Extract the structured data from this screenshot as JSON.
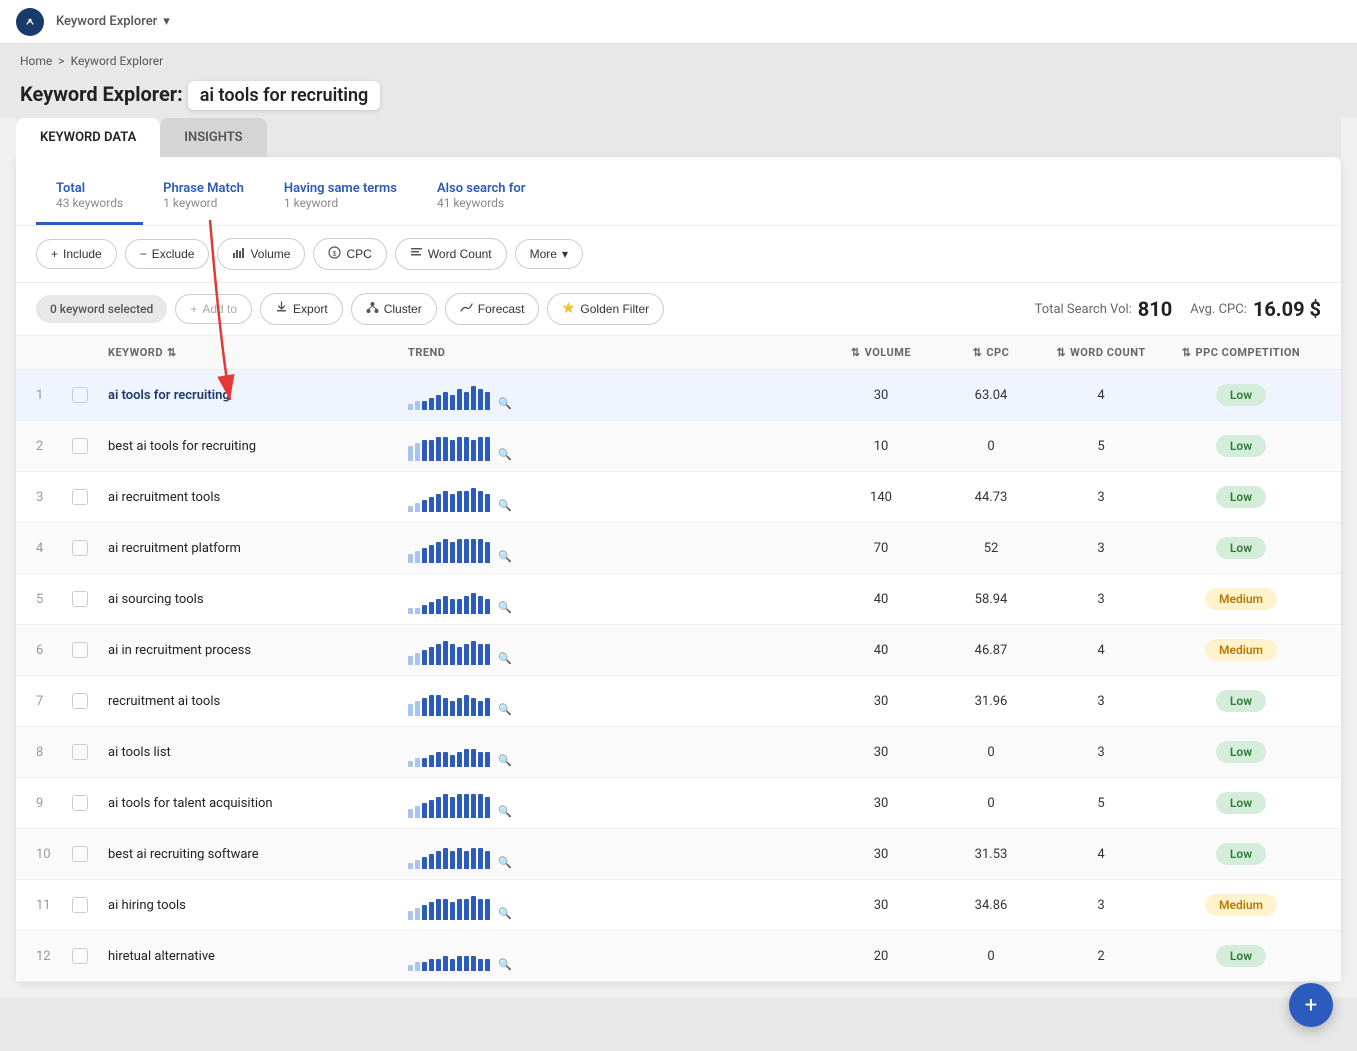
{
  "topbar": {
    "app_name": "Keyword Explorer",
    "chevron": "▾"
  },
  "breadcrumb": {
    "home": "Home",
    "separator": ">",
    "current": "Keyword Explorer"
  },
  "page_title": {
    "prefix": "Keyword Explorer:",
    "query": "ai tools for recruiting"
  },
  "tabs": [
    {
      "id": "keyword-data",
      "label": "KEYWORD DATA",
      "active": true
    },
    {
      "id": "insights",
      "label": "INSIGHTS",
      "active": false
    }
  ],
  "keyword_types": [
    {
      "id": "total",
      "label": "Total",
      "count": "43 keywords",
      "active": true
    },
    {
      "id": "phrase-match",
      "label": "Phrase Match",
      "count": "1 keyword",
      "active": false
    },
    {
      "id": "same-terms",
      "label": "Having same terms",
      "count": "1 keyword",
      "active": false
    },
    {
      "id": "also-search",
      "label": "Also search for",
      "count": "41 keywords",
      "active": false
    }
  ],
  "filters": [
    {
      "id": "include",
      "label": "Include",
      "icon": "+"
    },
    {
      "id": "exclude",
      "label": "Exclude",
      "icon": "−"
    },
    {
      "id": "volume",
      "label": "Volume",
      "icon": "📊"
    },
    {
      "id": "cpc",
      "label": "CPC",
      "icon": "💲"
    },
    {
      "id": "word-count",
      "label": "Word Count",
      "icon": "📝"
    },
    {
      "id": "more",
      "label": "More",
      "icon": "⋯",
      "has_arrow": true
    }
  ],
  "actions": {
    "selected_label": "0 keyword selected",
    "add_to": "+ Add to",
    "export": "Export",
    "cluster": "Cluster",
    "forecast": "Forecast",
    "golden_filter": "Golden Filter"
  },
  "totals": {
    "search_vol_label": "Total Search Vol:",
    "search_vol": "810",
    "avg_cpc_label": "Avg. CPC:",
    "avg_cpc": "16.09 $"
  },
  "table": {
    "headers": [
      {
        "id": "drag",
        "label": ""
      },
      {
        "id": "check",
        "label": ""
      },
      {
        "id": "keyword",
        "label": "KEYWORD"
      },
      {
        "id": "trend",
        "label": "TREND"
      },
      {
        "id": "volume",
        "label": "VOLUME"
      },
      {
        "id": "cpc",
        "label": "CPC"
      },
      {
        "id": "word-count",
        "label": "WORD COUNT"
      },
      {
        "id": "ppc",
        "label": "PPC COMPETITION"
      }
    ],
    "rows": [
      {
        "num": 1,
        "keyword": "ai tools for recruiting",
        "volume": 30,
        "cpc": "63.04",
        "word_count": 4,
        "ppc": "Low",
        "ppc_type": "low",
        "trend": [
          2,
          3,
          3,
          4,
          5,
          6,
          5,
          7,
          6,
          8,
          7,
          6
        ],
        "highlight": true
      },
      {
        "num": 2,
        "keyword": "best ai tools for recruiting",
        "volume": 10,
        "cpc": "0",
        "word_count": 5,
        "ppc": "Low",
        "ppc_type": "low",
        "trend": [
          5,
          6,
          7,
          7,
          8,
          8,
          7,
          8,
          8,
          7,
          8,
          8
        ]
      },
      {
        "num": 3,
        "keyword": "ai recruitment tools",
        "volume": 140,
        "cpc": "44.73",
        "word_count": 3,
        "ppc": "Low",
        "ppc_type": "low",
        "trend": [
          2,
          3,
          4,
          5,
          6,
          7,
          6,
          7,
          7,
          8,
          7,
          6
        ]
      },
      {
        "num": 4,
        "keyword": "ai recruitment platform",
        "volume": 70,
        "cpc": "52",
        "word_count": 3,
        "ppc": "Low",
        "ppc_type": "low",
        "trend": [
          3,
          4,
          5,
          6,
          7,
          8,
          7,
          8,
          8,
          8,
          8,
          7
        ]
      },
      {
        "num": 5,
        "keyword": "ai sourcing tools",
        "volume": 40,
        "cpc": "58.94",
        "word_count": 3,
        "ppc": "Medium",
        "ppc_type": "medium",
        "trend": [
          2,
          2,
          3,
          4,
          5,
          6,
          5,
          5,
          6,
          7,
          6,
          5
        ]
      },
      {
        "num": 6,
        "keyword": "ai in recruitment process",
        "volume": 40,
        "cpc": "46.87",
        "word_count": 4,
        "ppc": "Medium",
        "ppc_type": "medium",
        "trend": [
          3,
          4,
          5,
          6,
          7,
          8,
          7,
          6,
          7,
          8,
          7,
          7
        ]
      },
      {
        "num": 7,
        "keyword": "recruitment ai tools",
        "volume": 30,
        "cpc": "31.96",
        "word_count": 3,
        "ppc": "Low",
        "ppc_type": "low",
        "trend": [
          4,
          5,
          6,
          7,
          7,
          6,
          5,
          6,
          7,
          6,
          5,
          6
        ]
      },
      {
        "num": 8,
        "keyword": "ai tools list",
        "volume": 30,
        "cpc": "0",
        "word_count": 3,
        "ppc": "Low",
        "ppc_type": "low",
        "trend": [
          2,
          3,
          3,
          4,
          5,
          5,
          4,
          5,
          6,
          6,
          5,
          5
        ]
      },
      {
        "num": 9,
        "keyword": "ai tools for talent acquisition",
        "volume": 30,
        "cpc": "0",
        "word_count": 5,
        "ppc": "Low",
        "ppc_type": "low",
        "trend": [
          3,
          4,
          5,
          6,
          7,
          8,
          7,
          8,
          8,
          8,
          8,
          7
        ]
      },
      {
        "num": 10,
        "keyword": "best ai recruiting software",
        "volume": 30,
        "cpc": "31.53",
        "word_count": 4,
        "ppc": "Low",
        "ppc_type": "low",
        "trend": [
          2,
          3,
          4,
          5,
          6,
          7,
          6,
          7,
          6,
          7,
          7,
          6
        ]
      },
      {
        "num": 11,
        "keyword": "ai hiring tools",
        "volume": 30,
        "cpc": "34.86",
        "word_count": 3,
        "ppc": "Medium",
        "ppc_type": "medium",
        "trend": [
          3,
          4,
          5,
          6,
          7,
          7,
          6,
          7,
          7,
          8,
          7,
          7
        ]
      },
      {
        "num": 12,
        "keyword": "hiretual alternative",
        "volume": 20,
        "cpc": "0",
        "word_count": 2,
        "ppc": "Low",
        "ppc_type": "low",
        "trend": [
          2,
          3,
          3,
          4,
          4,
          5,
          4,
          5,
          5,
          5,
          4,
          4
        ]
      }
    ]
  },
  "fab": {
    "icon": "+"
  },
  "colors": {
    "accent": "#2b5bbd",
    "low_badge_bg": "#d4edda",
    "low_badge_text": "#2e7d32",
    "medium_badge_bg": "#fff3cd",
    "medium_badge_text": "#b87a00"
  }
}
